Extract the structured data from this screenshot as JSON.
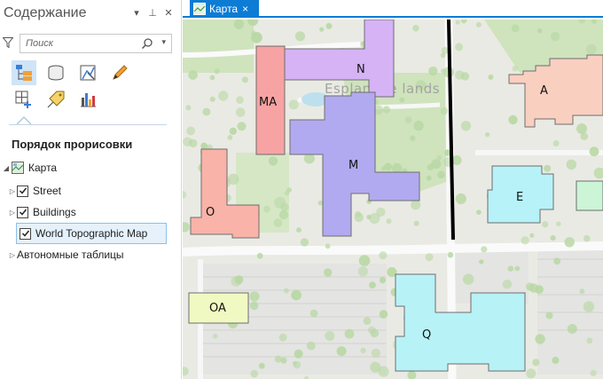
{
  "pane": {
    "title": "Содержание",
    "pin_glyph": "▾",
    "autohide_glyph": "⊥",
    "close_glyph": "✕",
    "search": {
      "placeholder": "Поиск"
    },
    "tools": [
      {
        "name": "list-by-drawing-order-icon",
        "selected": true
      },
      {
        "name": "list-by-data-source-icon",
        "selected": false
      },
      {
        "name": "list-by-selection-icon",
        "selected": false
      },
      {
        "name": "list-by-editing-icon",
        "selected": false
      },
      {
        "name": "list-by-snapping-icon",
        "selected": false
      },
      {
        "name": "list-by-labeling-icon",
        "selected": false
      },
      {
        "name": "list-by-charts-icon",
        "selected": false
      }
    ],
    "section_title": "Порядок прорисовки",
    "tree": {
      "map": {
        "label": "Карта"
      },
      "layers": [
        {
          "label": "Street",
          "checked": true
        },
        {
          "label": "Buildings",
          "checked": true
        },
        {
          "label": "World Topographic Map",
          "checked": true,
          "selected": true
        }
      ],
      "standalone": {
        "label": "Автономные таблицы"
      }
    }
  },
  "map_view": {
    "tab_label": "Карта",
    "tab_close": "×",
    "basemap_label": "Esplanade lands",
    "colors": {
      "accent": "#0c7cd5",
      "base": "#eaeae4",
      "tree": "#b8d8a4",
      "lawn": "#cfe3bd",
      "road": "#fafafa",
      "parking": "#e4e4e2",
      "water": "#bde0ee"
    },
    "buildings": [
      {
        "label": "N",
        "fill": "#d5b3f5"
      },
      {
        "label": "MA",
        "fill": "#f7a3a3"
      },
      {
        "label": "M",
        "fill": "#b1aaf0"
      },
      {
        "label": "A",
        "fill": "#f9cfc0"
      },
      {
        "label": "O",
        "fill": "#f9b3a8"
      },
      {
        "label": "E",
        "fill": "#b6f2f8"
      },
      {
        "label": "OA",
        "fill": "#f1f9c2"
      },
      {
        "label": "Q",
        "fill": "#b7f2f7"
      },
      {
        "label": "",
        "fill": "#cbf5d6"
      }
    ]
  }
}
